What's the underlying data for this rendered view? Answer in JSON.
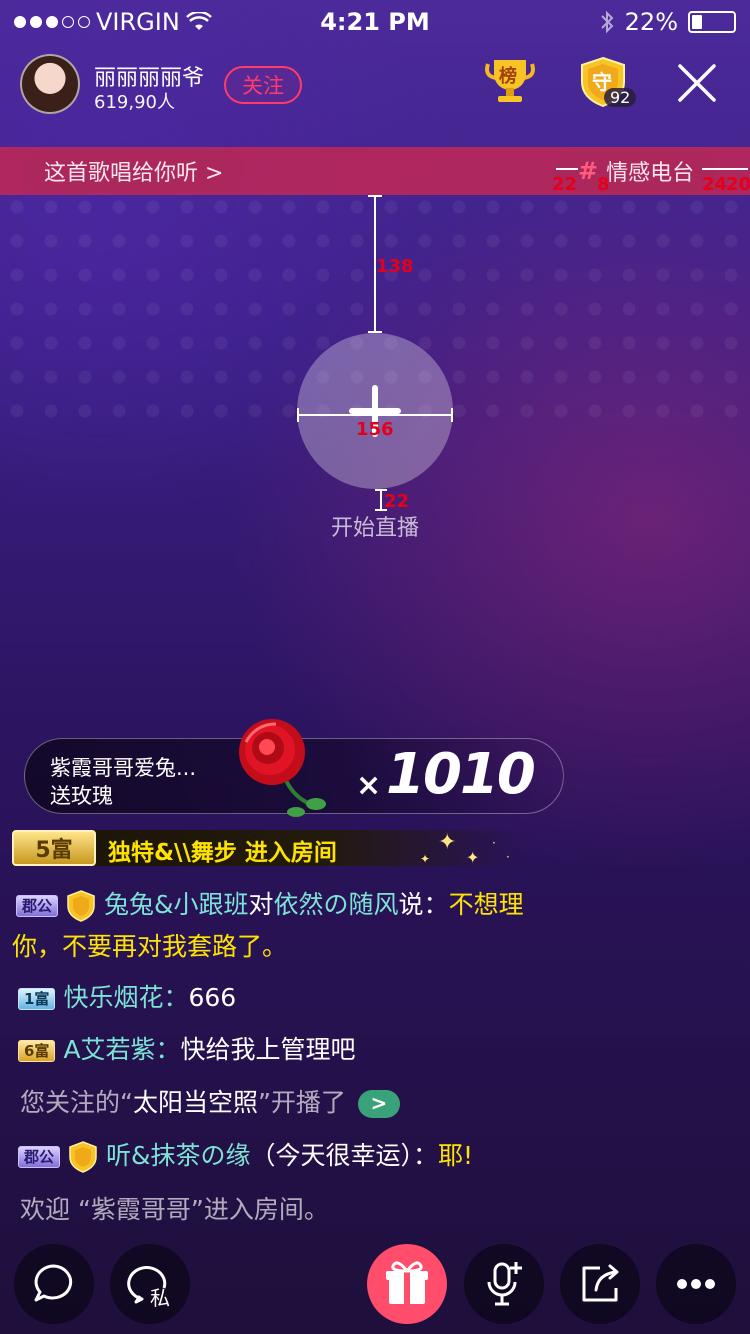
{
  "status_bar": {
    "carrier": "VIRGIN",
    "time": "4:21 PM",
    "battery": "22%"
  },
  "header": {
    "host_name": "丽丽丽丽爷",
    "viewers": "619,90人",
    "follow_label": "关注",
    "rank_label": "榜",
    "guard_label": "守",
    "guard_count": "92"
  },
  "banner": {
    "song_text": "这首歌唱给你听 >",
    "radio_hash": "#",
    "radio_text": "情感电台"
  },
  "annotations": {
    "pad_left": "22",
    "hash_gap": "8",
    "pad_right_a": "24",
    "pad_right_b": "20",
    "top_gap": "138",
    "circle_size": "156",
    "label_gap": "22"
  },
  "center": {
    "start_label": "开始直播"
  },
  "gift": {
    "sender": "紫霞哥哥爱兔...",
    "action": "送玫瑰",
    "times_symbol": "×",
    "count": "1010"
  },
  "entrance": {
    "level_badge": "5富",
    "text": "独特&\\\\舞步 进入房间"
  },
  "chat": [
    {
      "badge": "郡公",
      "user": "兔兔&小跟班",
      "mid": "对",
      "target": "依然の随风",
      "say": "说：",
      "msg1": "不想理",
      "msg2": "你，不要再对我套路了。"
    },
    {
      "badge": "1富",
      "user": "快乐烟花：",
      "msg": "666"
    },
    {
      "badge": "6富",
      "user": "A艾若紫：",
      "msg": "快给我上管理吧"
    },
    {
      "pre": "您关注的“",
      "name": "太阳当空照",
      "post": "”开播了",
      "go": ">"
    },
    {
      "badge": "郡公",
      "user": "听&抹茶の缘",
      "msg": "（今天很幸运）：",
      "emph": "耶!"
    },
    {
      "text": "欢迎 “紫霞哥哥”进入房间。"
    }
  ],
  "toolbar": {
    "private_label": "私"
  },
  "colors": {
    "accent_pink": "#ff4d6b",
    "follow_red": "#ff3b6a",
    "chat_name_cyan": "#7de3d5",
    "highlight_yellow": "#ffe300",
    "go_green": "#39a27a"
  }
}
